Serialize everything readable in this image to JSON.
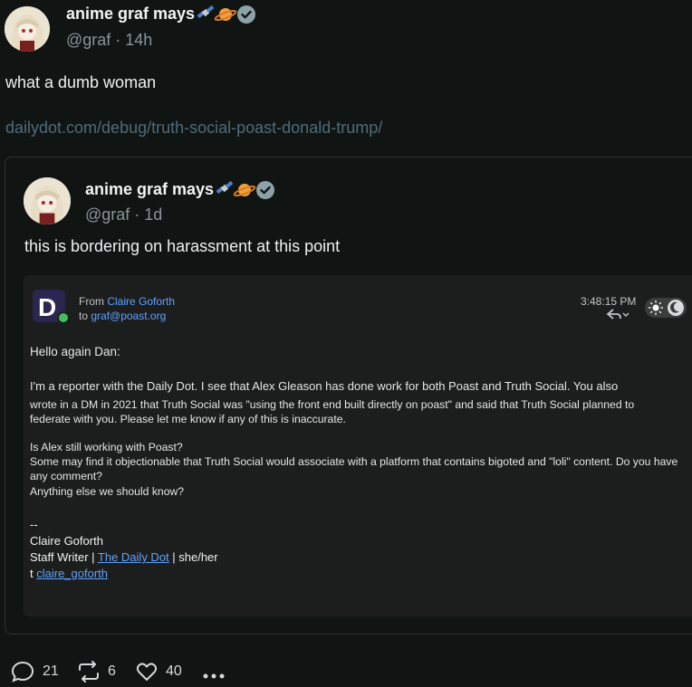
{
  "post": {
    "author_name": "anime graf mays",
    "handle_time": "@graf · 14h",
    "text": "what a dumb woman",
    "link": "dailydot.com/debug/truth-social-poast-donald-trump/"
  },
  "quoted": {
    "author_name": "anime graf mays",
    "handle_time": "@graf · 1d",
    "text": "this is bordering on harassment at this point"
  },
  "email": {
    "from_prefix": "From ",
    "from_name": "Claire Goforth",
    "to_prefix": "to ",
    "to_address": "graf@poast.org",
    "time": "3:48:15 PM",
    "greeting": "Hello again Dan:",
    "para1_line1": "I'm a reporter with the Daily Dot. I see that Alex Gleason has done work for both Poast and Truth Social. You also",
    "para1_line2": "wrote in a DM in 2021 that Truth Social was \"using the front end built directly on poast\" and said that Truth Social planned to",
    "para1_line3": "federate with you. Please let me know if any of this is inaccurate.",
    "q1": "Is Alex still working with Poast?",
    "q2_line1": "Some may find it objectionable that Truth Social would associate with a platform that contains bigoted and \"loli\" content. Do you have",
    "q2_line2": "any comment?",
    "q3": "Anything else we should know?",
    "sig_dash": "--",
    "sig_name": "Claire Goforth",
    "sig_title_prefix": "Staff Writer | ",
    "sig_outlet": "The Daily Dot",
    "sig_pronouns": " | she/her",
    "sig_t_prefix": "t ",
    "sig_twitter": "claire_goforth"
  },
  "actions": {
    "replies": "21",
    "reposts": "6",
    "likes": "40"
  },
  "colors": {
    "background": "#101513",
    "verified": "#8fa1a8",
    "link": "#4f6b79",
    "email_link": "#5fa2ff"
  }
}
